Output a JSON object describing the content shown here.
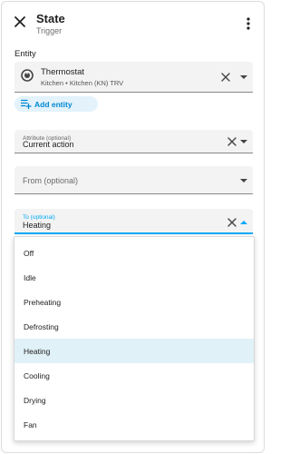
{
  "header": {
    "title": "State",
    "subtitle": "Trigger"
  },
  "entity_section": {
    "label": "Entity",
    "entity": {
      "name": "Thermostat",
      "area": "Kitchen",
      "separator": "•",
      "device": "Kitchen (KN) TRV",
      "icon": "thermostat-icon"
    },
    "add_button": "Add entity"
  },
  "attribute_field": {
    "label": "Attribute (optional)",
    "value": "Current action"
  },
  "from_field": {
    "label": "From (optional)",
    "value": ""
  },
  "to_field": {
    "label": "To (optional)",
    "value": "Heating",
    "expanded": true
  },
  "dropdown": {
    "options": [
      "Off",
      "Idle",
      "Preheating",
      "Defrosting",
      "Heating",
      "Cooling",
      "Drying",
      "Fan"
    ],
    "selected": "Heating"
  },
  "colors": {
    "accent": "#03a9f4",
    "chip_bg": "#e3f2fb",
    "chip_text": "#0288d1",
    "selected_bg": "#e1f1f8",
    "field_bg": "#f3f3f3"
  }
}
